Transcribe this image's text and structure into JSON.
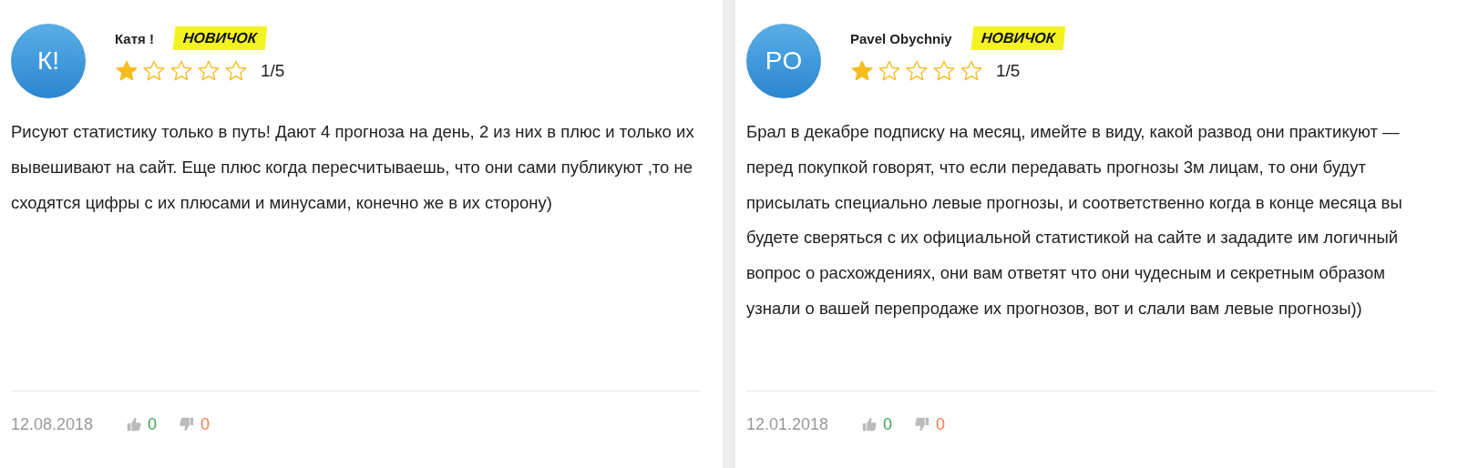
{
  "reviews": [
    {
      "initials": "К!",
      "name": "Катя !",
      "badge": "НОВИЧОК",
      "stars": 1,
      "rating": "1/5",
      "text": "Рисуют статистику только в путь! Дают 4 прогноза на день, 2 из них в плюс и только их вывешивают на сайт. Еще плюс когда пересчитываешь, что они сами публикуют ,то не сходятся цифры с их плюсами и минусами, конечно же в их сторону)",
      "date": "12.08.2018",
      "likes": "0",
      "dislikes": "0"
    },
    {
      "initials": "PO",
      "name": "Pavel Obychniy",
      "badge": "НОВИЧОК",
      "stars": 1,
      "rating": "1/5",
      "text": "Брал в декабре подписку на месяц, имейте в виду, какой развод они практикуют — перед покупкой говорят, что если передавать прогнозы 3м лицам, то они будут присылать специально левые прогнозы, и соответственно когда в конце месяца вы будете сверяться с их официальной статистикой на сайте и зададите им логичный вопрос о расхождениях, они вам ответят что они чудесным и секретным образом узнали о вашей перепродаже их прогнозов, вот и слали вам левые прогнозы))",
      "date": "12.01.2018",
      "likes": "0",
      "dislikes": "0"
    }
  ]
}
